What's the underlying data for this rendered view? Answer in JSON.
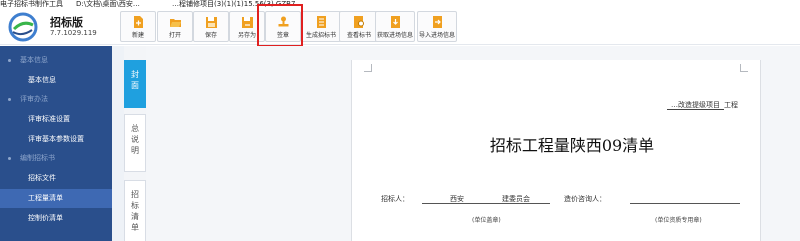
{
  "titlebar": {
    "app": "电子招标书制作工具",
    "path": "D:\\文档\\桌面\\西安…",
    "project": "…程铺修项目(3)(1)(1)15.56(3).GZB7"
  },
  "header": {
    "app_name": "招标版",
    "version": "7.7.1029.119"
  },
  "toolbar": [
    {
      "name": "new-button",
      "icon": "new-file-icon",
      "label": "新建"
    },
    {
      "name": "open-button",
      "icon": "folder-open-icon",
      "label": "打开"
    },
    {
      "name": "save-button",
      "icon": "save-icon",
      "label": "保存"
    },
    {
      "name": "save-as-button",
      "icon": "save-as-icon",
      "label": "另存为"
    },
    {
      "name": "sign-button",
      "icon": "stamp-icon",
      "label": "签章"
    },
    {
      "name": "generate-tender-button",
      "icon": "document-icon",
      "label": "生成招标书"
    },
    {
      "name": "view-tender-button",
      "icon": "view-document-icon",
      "label": "查看标书"
    },
    {
      "name": "get-progress-button",
      "icon": "download-file-icon",
      "label": "获取进场信息"
    },
    {
      "name": "import-progress-button",
      "icon": "import-file-icon",
      "label": "导入进场信息"
    }
  ],
  "sidebar": {
    "sections": [
      {
        "title": "基本信息",
        "items": [
          {
            "label": "基本信息",
            "active": false
          }
        ]
      },
      {
        "title": "评审办法",
        "items": [
          {
            "label": "评审标准设置",
            "active": false
          },
          {
            "label": "评审基本参数设置",
            "active": false
          }
        ]
      },
      {
        "title": "编制招标书",
        "items": [
          {
            "label": "招标文件",
            "active": false
          },
          {
            "label": "工程量清单",
            "active": true
          },
          {
            "label": "控制价清单",
            "active": false
          }
        ]
      }
    ]
  },
  "vtabs": [
    {
      "label": "封面",
      "active": true
    },
    {
      "label": "总说明",
      "active": false
    },
    {
      "label": "招标清单",
      "active": false
    }
  ],
  "document": {
    "project_suffix": "…改造提级项目",
    "project_tail": "工程",
    "title": "招标工程量陕西09清单",
    "tenderer_label": "招标人：",
    "tenderer_value_1": "西安",
    "tenderer_value_2": "建委员会",
    "consultant_label": "造价咨询人：",
    "note_left": "(单位盖章)",
    "note_right": "(单位资质专用章)"
  },
  "colors": {
    "sidebar_bg": "#2a4f8c",
    "sidebar_active": "#3e69b3",
    "tab_active": "#1fa0df",
    "highlight": "#e02020",
    "icon_orange": "#f0a020"
  }
}
